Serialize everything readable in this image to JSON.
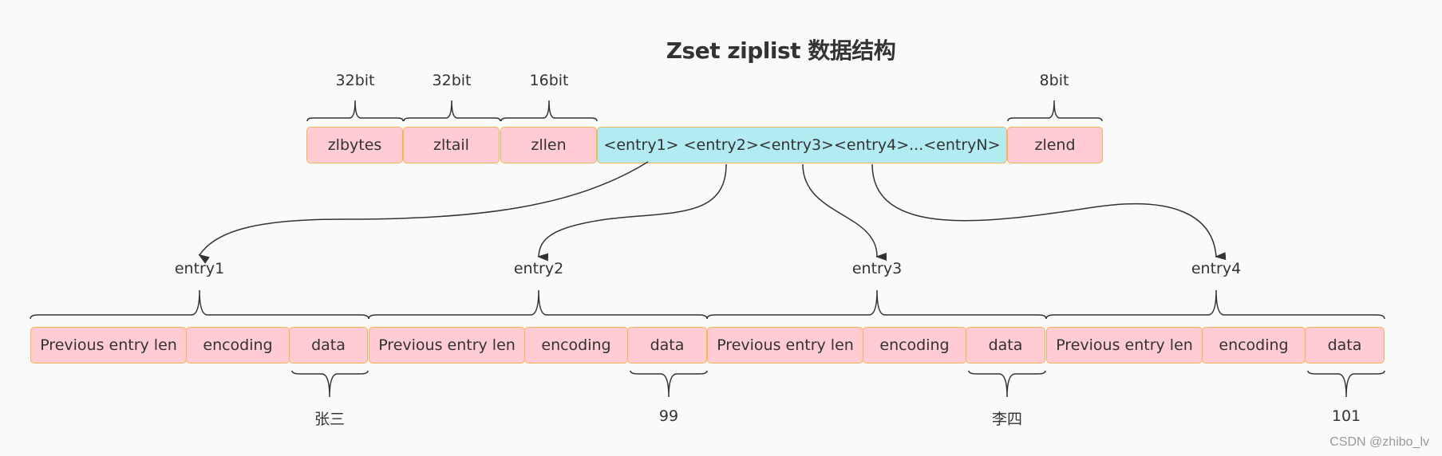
{
  "title": "Zset ziplist 数据结构",
  "header": {
    "fields": [
      {
        "label": "zlbytes",
        "size": "32bit"
      },
      {
        "label": "zltail",
        "size": "32bit"
      },
      {
        "label": "zllen",
        "size": "16bit"
      },
      {
        "label": "<entry1> <entry2><entry3><entry4>...<entryN>",
        "size": ""
      },
      {
        "label": "zlend",
        "size": "8bit"
      }
    ]
  },
  "entries": [
    {
      "name": "entry1",
      "fields": [
        "Previous entry len",
        "encoding",
        "data"
      ],
      "data_value": "张三"
    },
    {
      "name": "entry2",
      "fields": [
        "Previous entry len",
        "encoding",
        "data"
      ],
      "data_value": "99"
    },
    {
      "name": "entry3",
      "fields": [
        "Previous entry len",
        "encoding",
        "data"
      ],
      "data_value": "李四"
    },
    {
      "name": "entry4",
      "fields": [
        "Previous entry len",
        "encoding",
        "data"
      ],
      "data_value": "101"
    }
  ],
  "colors": {
    "field_fill": "#ffccd3",
    "entries_fill": "#b2ebf2",
    "border": "#f5b456",
    "line": "#333333"
  },
  "watermark": "CSDN @zhibo_lv"
}
